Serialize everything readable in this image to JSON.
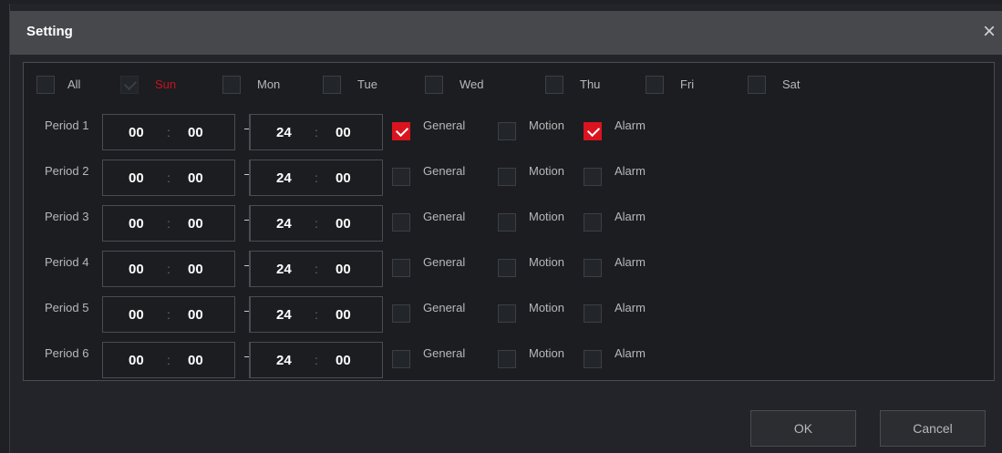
{
  "window": {
    "title": "Setting",
    "close_label": "×"
  },
  "days": [
    {
      "label": "All",
      "checked": false,
      "highlight": false
    },
    {
      "label": "Sun",
      "checked": true,
      "highlight": true
    },
    {
      "label": "Mon",
      "checked": false,
      "highlight": false
    },
    {
      "label": "Tue",
      "checked": false,
      "highlight": false
    },
    {
      "label": "Wed",
      "checked": false,
      "highlight": false
    },
    {
      "label": "Thu",
      "checked": false,
      "highlight": false
    },
    {
      "label": "Fri",
      "checked": false,
      "highlight": false
    },
    {
      "label": "Sat",
      "checked": false,
      "highlight": false
    }
  ],
  "periods": [
    {
      "label": "Period 1",
      "start_h": "00",
      "start_m": "00",
      "end_h": "24",
      "end_m": "00",
      "general": true,
      "motion": false,
      "alarm": true
    },
    {
      "label": "Period 2",
      "start_h": "00",
      "start_m": "00",
      "end_h": "24",
      "end_m": "00",
      "general": false,
      "motion": false,
      "alarm": false
    },
    {
      "label": "Period 3",
      "start_h": "00",
      "start_m": "00",
      "end_h": "24",
      "end_m": "00",
      "general": false,
      "motion": false,
      "alarm": false
    },
    {
      "label": "Period 4",
      "start_h": "00",
      "start_m": "00",
      "end_h": "24",
      "end_m": "00",
      "general": false,
      "motion": false,
      "alarm": false
    },
    {
      "label": "Period 5",
      "start_h": "00",
      "start_m": "00",
      "end_h": "24",
      "end_m": "00",
      "general": false,
      "motion": false,
      "alarm": false
    },
    {
      "label": "Period 6",
      "start_h": "00",
      "start_m": "00",
      "end_h": "24",
      "end_m": "00",
      "general": false,
      "motion": false,
      "alarm": false
    }
  ],
  "labels": {
    "general": "General",
    "motion": "Motion",
    "alarm": "Alarm",
    "colon": ":",
    "dash": "-"
  },
  "buttons": {
    "ok": "OK",
    "cancel": "Cancel"
  },
  "colors": {
    "accent": "#d9141f",
    "background": "#1b1d21",
    "titlebar": "#46484c"
  }
}
